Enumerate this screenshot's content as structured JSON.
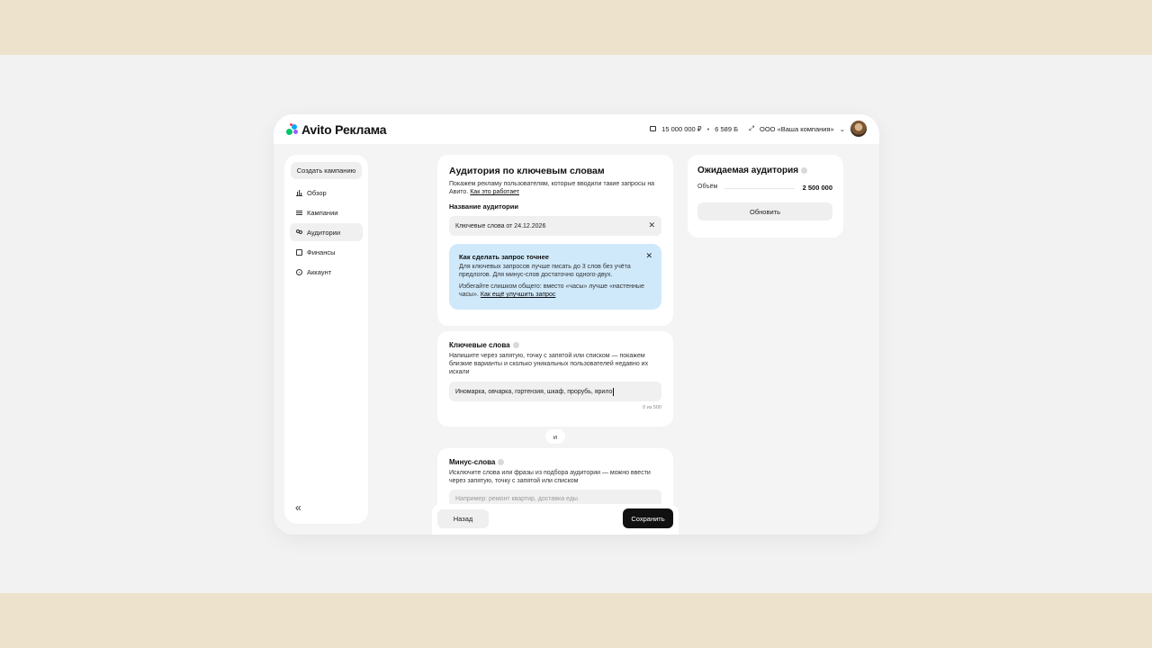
{
  "header": {
    "logo_text": "Avito Реклама",
    "balance": "15 000 000 ₽",
    "bonus": "6 589 Б",
    "company": "ООО «Ваша компания»",
    "icons": [
      "wallet-icon",
      "swap-icon",
      "chevron-down-icon"
    ]
  },
  "sidebar": {
    "create_label": "Создать кампанию",
    "items": [
      {
        "label": "Обзор",
        "icon": "chart-icon",
        "active": false
      },
      {
        "label": "Кампании",
        "icon": "list-icon",
        "active": false
      },
      {
        "label": "Аудитории",
        "icon": "users-icon",
        "active": true
      },
      {
        "label": "Финансы",
        "icon": "wallet-icon",
        "active": false
      },
      {
        "label": "Аккаунт",
        "icon": "gear-icon",
        "active": false
      }
    ],
    "collapse_glyph": "«"
  },
  "audience": {
    "title": "Аудитория по ключевым словам",
    "desc": "Покажем рекламу пользователям, которые вводили такие запросы на Авито.",
    "desc_link": "Как это работает",
    "name_label": "Название аудитории",
    "name_value": "Ключевые слова от 24.12.2026",
    "tip": {
      "title": "Как сделать запрос точнее",
      "text1": "Для ключевых запросов лучше писать до 3 слов без учёта предлогов. Для минус-слов достаточно одного-двух.",
      "text2": "Избегайте слишком общего: вместо «часы» лучше «настенные часы».",
      "link": "Как ещё улучшить запрос"
    }
  },
  "keywords": {
    "title": "Ключевые слова",
    "desc": "Напишите через запятую, точку с запятой или списком — покажем близкие варианты и сколько уникальных пользователей недавно их искали",
    "value": "Иномарка, овчарка, гортензия, шкаф, прорубь, ярило",
    "counter": "0 из 500"
  },
  "and_label": "и",
  "minus": {
    "title": "Минус-слова",
    "desc": "Исключите слова или фразы из подбора аудитории — можно ввести через запятую, точку с запятой или списком",
    "placeholder": "Например: ремонт квартир, доставка еды"
  },
  "footer": {
    "back_label": "Назад",
    "save_label": "Сохранить"
  },
  "expected": {
    "title": "Ожидаемая аудитория",
    "volume_label": "Объём",
    "volume_value": "2 500 000",
    "update_label": "Обновить"
  },
  "colors": {
    "accent_tip": "#cfe9fb",
    "primary_button": "#111111",
    "logo_green": "#00c46b",
    "logo_blue": "#0aa7ff",
    "logo_purple": "#9b5cff",
    "logo_red": "#ff4053"
  }
}
